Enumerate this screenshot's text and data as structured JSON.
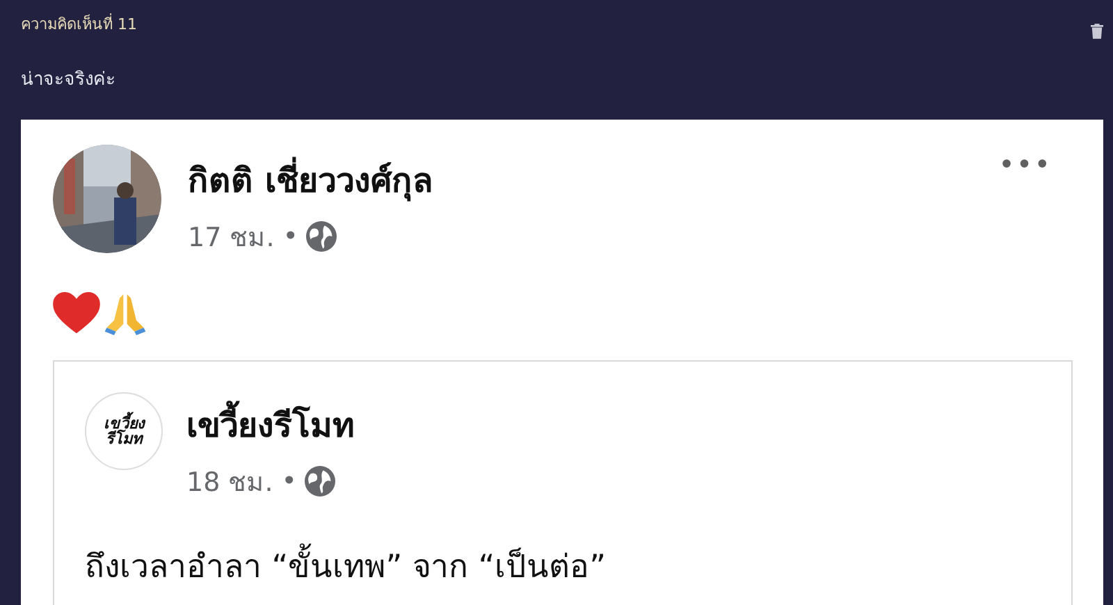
{
  "comment": {
    "label": "ความคิดเห็นที่ 11",
    "text": "น่าจะจริงค่ะ"
  },
  "post": {
    "author": "กิตติ เชี่ยววงศ์กุล",
    "time": "17 ชม.",
    "separator": "•",
    "more": "•••",
    "shared": {
      "logo": [
        "เขวี้ยง",
        "รีโมท"
      ],
      "author": "เขวี้ยงรีโมท",
      "time": "18 ชม.",
      "separator": "•",
      "text": "ถึงเวลาอำลา “ขั้นเทพ” จาก “เป็นต่อ”"
    }
  }
}
